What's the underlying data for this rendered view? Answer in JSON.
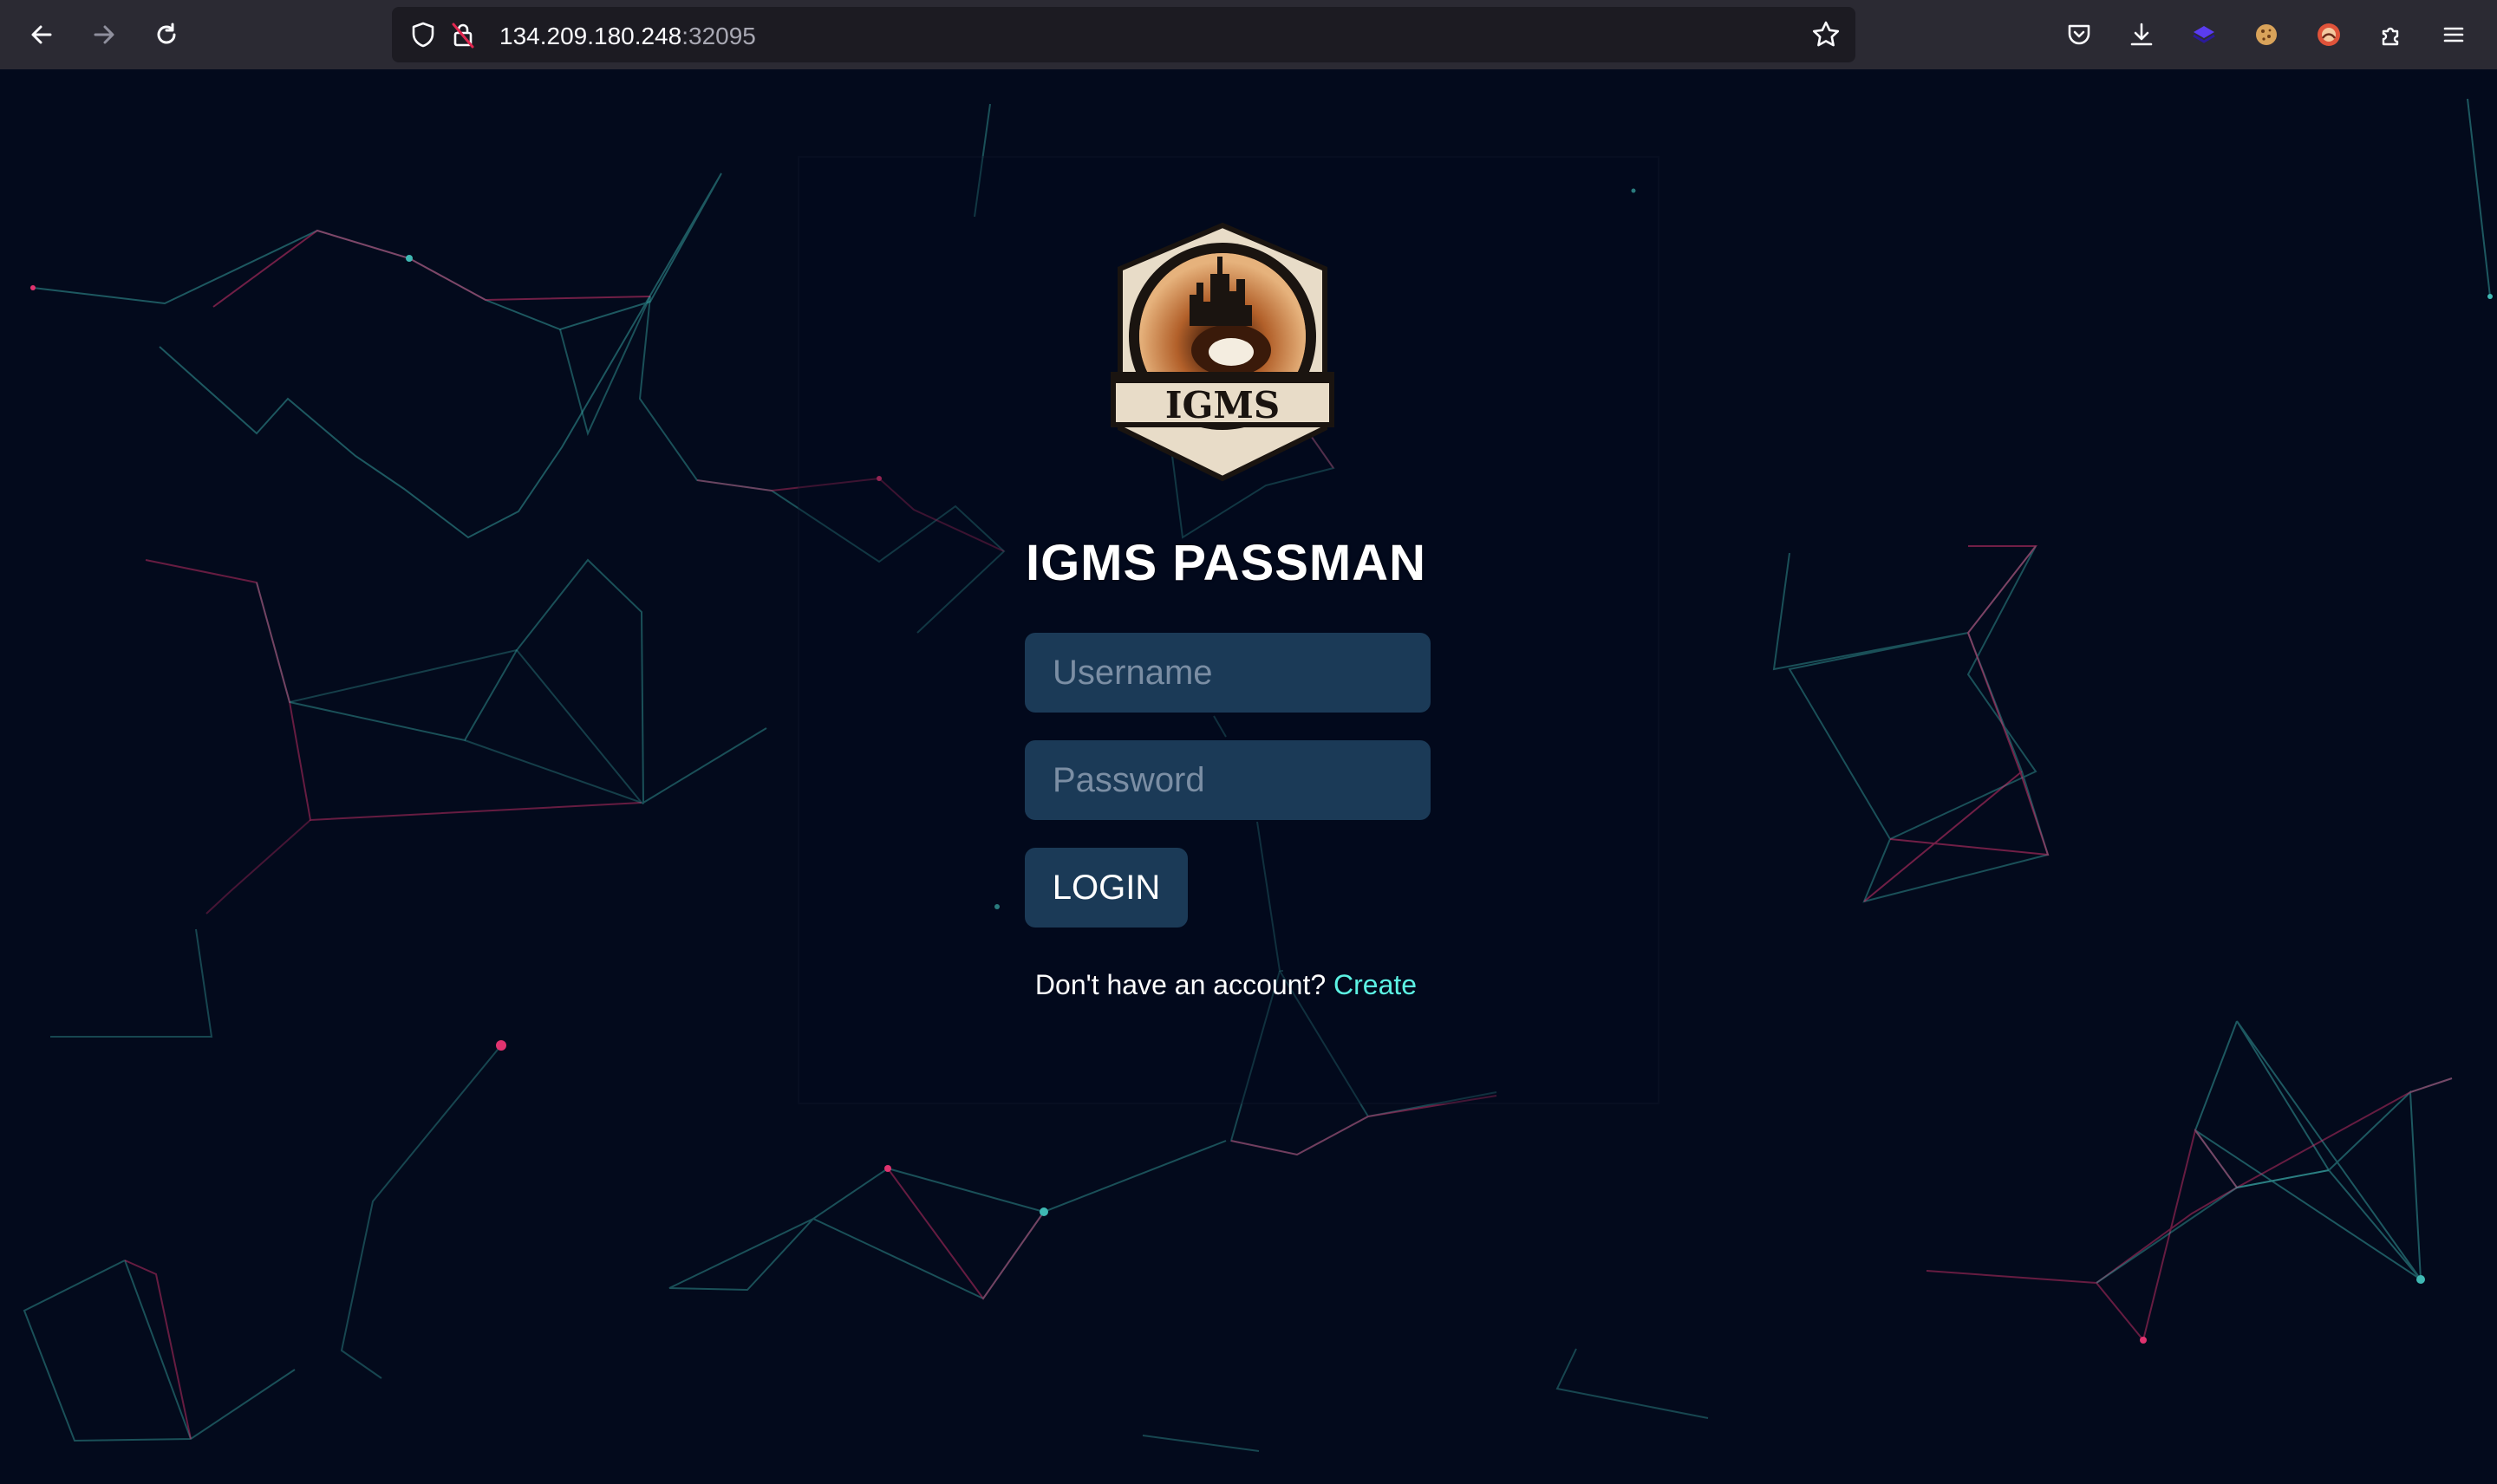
{
  "browser": {
    "url_host": "134.209.180.248",
    "url_port": ":32095",
    "toolbar_icons": [
      "back-arrow-icon",
      "forward-arrow-icon",
      "reload-icon",
      "shield-icon",
      "insecure-lock-icon",
      "bookmark-star-icon",
      "pocket-icon",
      "download-icon",
      "extension-cube-icon",
      "cookie-extension-icon",
      "avatar-extension-icon",
      "extensions-puzzle-icon",
      "hamburger-menu-icon"
    ]
  },
  "app": {
    "logo_text": "IGMS",
    "title": "IGMS PASSMAN"
  },
  "login_form": {
    "username_placeholder": "Username",
    "username_value": "",
    "password_placeholder": "Password",
    "password_value": "",
    "login_label": "LOGIN",
    "signup_prompt": "Don't have an account?",
    "signup_link": "Create"
  },
  "colors": {
    "background": "#030a1c",
    "input_background": "#1b3a57",
    "link": "#5cf2e3",
    "network_cyan": "#3fb8b3",
    "network_pink": "#e0336f"
  }
}
